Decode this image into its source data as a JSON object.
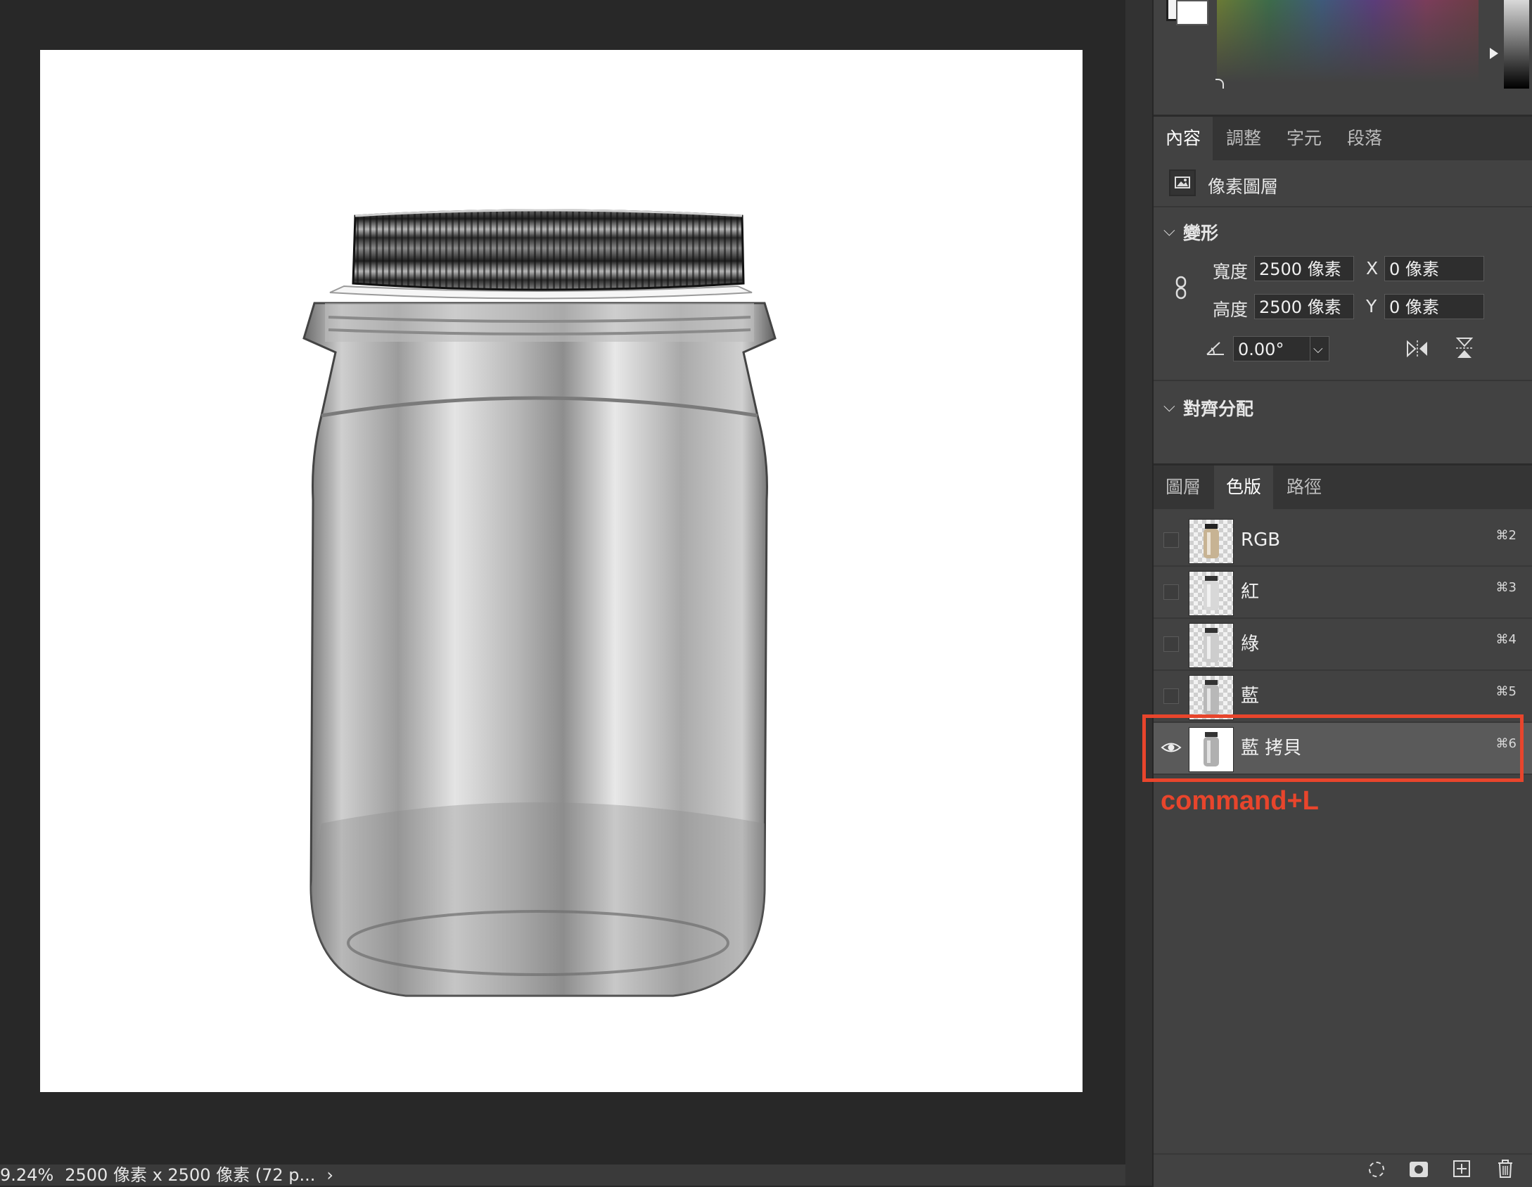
{
  "status": {
    "zoom": "9.24%",
    "doc_info": "2500 像素 x 2500 像素 (72 p...",
    "arrow": "›"
  },
  "properties": {
    "tabs": [
      {
        "label": "內容",
        "active": true
      },
      {
        "label": "調整",
        "active": false
      },
      {
        "label": "字元",
        "active": false
      },
      {
        "label": "段落",
        "active": false
      }
    ],
    "layer_type": "像素圖層",
    "transform": {
      "section_label": "變形",
      "width_label": "寬度",
      "width_value": "2500 像素",
      "height_label": "高度",
      "height_value": "2500 像素",
      "x_label": "X",
      "x_value": "0 像素",
      "y_label": "Y",
      "y_value": "0 像素",
      "angle_value": "0.00°"
    },
    "align": {
      "section_label": "對齊分配"
    }
  },
  "channels_panel": {
    "tabs": [
      {
        "label": "圖層",
        "active": false
      },
      {
        "label": "色版",
        "active": true
      },
      {
        "label": "路徑",
        "active": false
      }
    ],
    "channels": [
      {
        "name": "RGB",
        "shortcut": "⌘2",
        "visible": false,
        "selected": false
      },
      {
        "name": "紅",
        "shortcut": "⌘3",
        "visible": false,
        "selected": false
      },
      {
        "name": "綠",
        "shortcut": "⌘4",
        "visible": false,
        "selected": false
      },
      {
        "name": "藍",
        "shortcut": "⌘5",
        "visible": false,
        "selected": false
      },
      {
        "name": "藍 拷貝",
        "shortcut": "⌘6",
        "visible": true,
        "selected": true
      }
    ],
    "annotation": "command+L",
    "annotation_color": "#e8452c"
  },
  "bottom_icons": [
    "selection-icon",
    "mask-icon",
    "new-channel-icon",
    "trash-icon"
  ],
  "colors": {
    "canvas": "#ffffff",
    "workspace": "#282828",
    "panel": "#424242",
    "highlight": "#e8452c"
  }
}
